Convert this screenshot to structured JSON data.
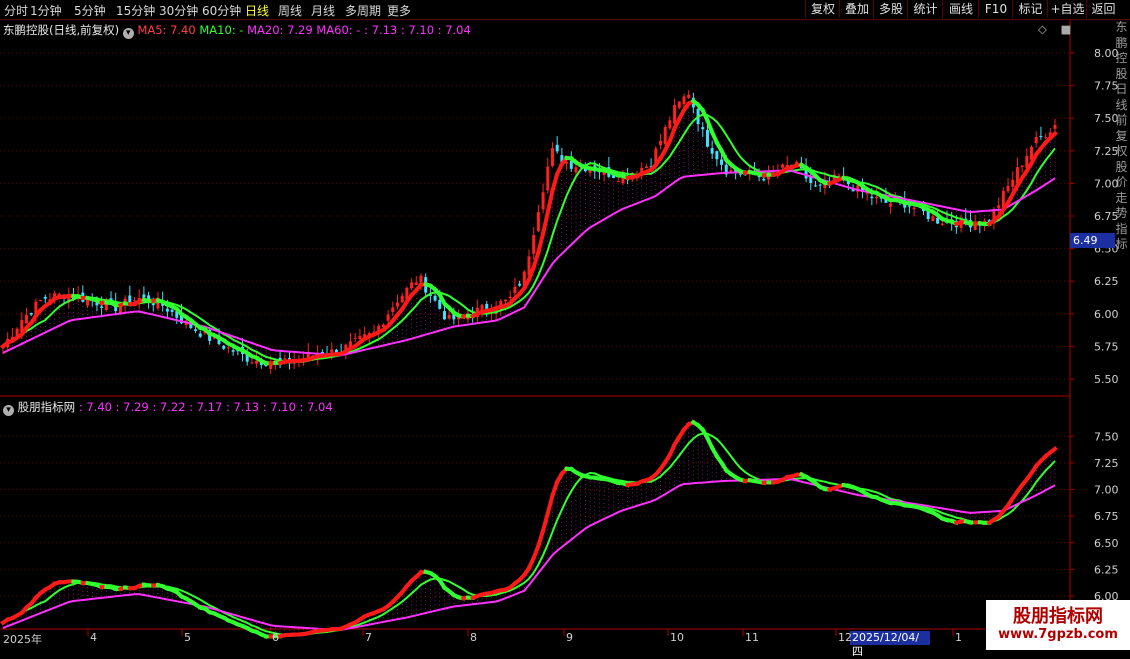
{
  "toolbar": {
    "timeframes": [
      "分时",
      "1分钟",
      "5分钟",
      "15分钟",
      "30分钟",
      "60分钟",
      "日线",
      "周线",
      "月线",
      "多周期",
      "更多"
    ],
    "active_timeframe": "日线",
    "right_buttons": [
      "复权",
      "叠加",
      "多股",
      "统计",
      "画线",
      "F10",
      "标记",
      "+自选",
      "返回"
    ]
  },
  "main_panel": {
    "stock_name": "东鹏控股(日线,前复权)",
    "ma5": "MA5: 7.40",
    "ma10": "MA10: -",
    "ma20": "MA20: 7.29",
    "ma60": "MA60: - : 7.13 : 7.10 : 7.04",
    "price_badge": "6.49",
    "side_text": "东鹏控股日线前复权股价走势指标"
  },
  "sub_panel": {
    "indicator_name": "股朋指标网",
    "values": ": 7.40 : 7.29 : 7.22 : 7.17 : 7.13 : 7.10 : 7.04"
  },
  "x_axis": {
    "month_labels": [
      "2025年",
      "4",
      "5",
      "6",
      "7",
      "8",
      "9",
      "10",
      "11",
      "12",
      "1"
    ],
    "selected_date": "2025/12/04/四"
  },
  "watermark": {
    "line1": "股朋指标网",
    "line2": "www.7gpzb.com"
  },
  "colors": {
    "up": "#ff2020",
    "down": "#40e0ff",
    "ma_short": "#ff1a1a",
    "ma_mid": "#30ff30",
    "ma_long": "#ff30ff",
    "axis": "#b00000",
    "active_tab": "#ffff40"
  },
  "chart_data": {
    "type": "line",
    "main_y_ticks": [
      5.5,
      5.75,
      6.0,
      6.25,
      6.5,
      6.75,
      7.0,
      7.25,
      7.5,
      7.75,
      8.0
    ],
    "sub_y_ticks": [
      6.0,
      6.25,
      6.5,
      6.75,
      7.0,
      7.25,
      7.5
    ],
    "main_ylim": [
      5.4,
      8.1
    ],
    "sub_ylim": [
      5.85,
      7.7
    ],
    "days": 225,
    "close_anchors": [
      [
        0,
        5.75
      ],
      [
        8,
        5.95
      ],
      [
        18,
        6.12
      ],
      [
        28,
        6.15
      ],
      [
        40,
        6.1
      ],
      [
        50,
        6.05
      ],
      [
        60,
        6.12
      ],
      [
        70,
        6.08
      ],
      [
        82,
        5.92
      ],
      [
        95,
        5.78
      ],
      [
        110,
        5.65
      ],
      [
        125,
        5.62
      ],
      [
        138,
        5.68
      ],
      [
        150,
        5.72
      ],
      [
        165,
        5.85
      ],
      [
        175,
        6.1
      ],
      [
        185,
        6.28
      ],
      [
        192,
        6.1
      ],
      [
        198,
        5.95
      ],
      [
        205,
        5.98
      ],
      [
        215,
        6.05
      ],
      [
        225,
        6.1
      ],
      [
        232,
        6.3
      ],
      [
        238,
        6.8
      ],
      [
        244,
        7.25
      ],
      [
        252,
        7.15
      ],
      [
        262,
        7.12
      ],
      [
        275,
        7.05
      ],
      [
        288,
        7.15
      ],
      [
        298,
        7.55
      ],
      [
        305,
        7.7
      ],
      [
        312,
        7.35
      ],
      [
        322,
        7.1
      ],
      [
        338,
        7.05
      ],
      [
        352,
        7.15
      ],
      [
        362,
        6.95
      ],
      [
        372,
        7.05
      ],
      [
        380,
        6.95
      ],
      [
        392,
        6.85
      ],
      [
        402,
        6.85
      ],
      [
        415,
        6.72
      ],
      [
        425,
        6.7
      ],
      [
        438,
        6.7
      ],
      [
        448,
        7.0
      ],
      [
        458,
        7.3
      ],
      [
        468,
        7.45
      ]
    ],
    "ma_long_anchors": [
      [
        0,
        5.7
      ],
      [
        30,
        5.95
      ],
      [
        60,
        6.02
      ],
      [
        90,
        5.9
      ],
      [
        120,
        5.72
      ],
      [
        150,
        5.68
      ],
      [
        180,
        5.8
      ],
      [
        200,
        5.9
      ],
      [
        220,
        5.95
      ],
      [
        232,
        6.05
      ],
      [
        245,
        6.4
      ],
      [
        260,
        6.65
      ],
      [
        275,
        6.8
      ],
      [
        290,
        6.9
      ],
      [
        302,
        7.05
      ],
      [
        320,
        7.08
      ],
      [
        350,
        7.1
      ],
      [
        380,
        6.95
      ],
      [
        410,
        6.85
      ],
      [
        430,
        6.78
      ],
      [
        445,
        6.8
      ],
      [
        460,
        6.95
      ],
      [
        468,
        7.04
      ]
    ]
  }
}
